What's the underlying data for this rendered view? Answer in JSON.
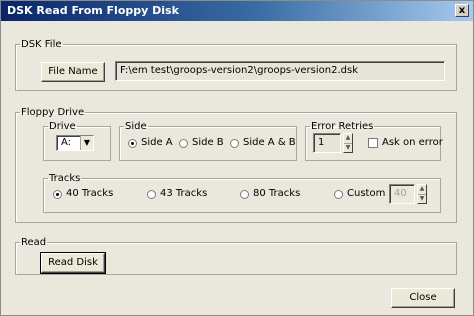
{
  "window": {
    "title": "DSK Read From Floppy Disk",
    "close_glyph": "x"
  },
  "dsk_file": {
    "legend": "DSK File",
    "button_label": "File Name",
    "path_value": "F:\\em test\\groops-version2\\groops-version2.dsk"
  },
  "floppy": {
    "legend": "Floppy Drive",
    "drive": {
      "legend": "Drive",
      "value": "A:"
    },
    "side": {
      "legend": "Side",
      "options": [
        "Side A",
        "Side B",
        "Side A & B"
      ],
      "selected": 0
    },
    "retries": {
      "legend": "Error Retries",
      "value": "1",
      "ask_label": "Ask on error",
      "ask_checked": false
    },
    "tracks": {
      "legend": "Tracks",
      "options": [
        "40 Tracks",
        "43 Tracks",
        "80 Tracks",
        "Custom"
      ],
      "selected": 0,
      "custom_value": "40"
    }
  },
  "read": {
    "legend": "Read",
    "button_label": "Read Disk"
  },
  "footer": {
    "close_label": "Close"
  }
}
